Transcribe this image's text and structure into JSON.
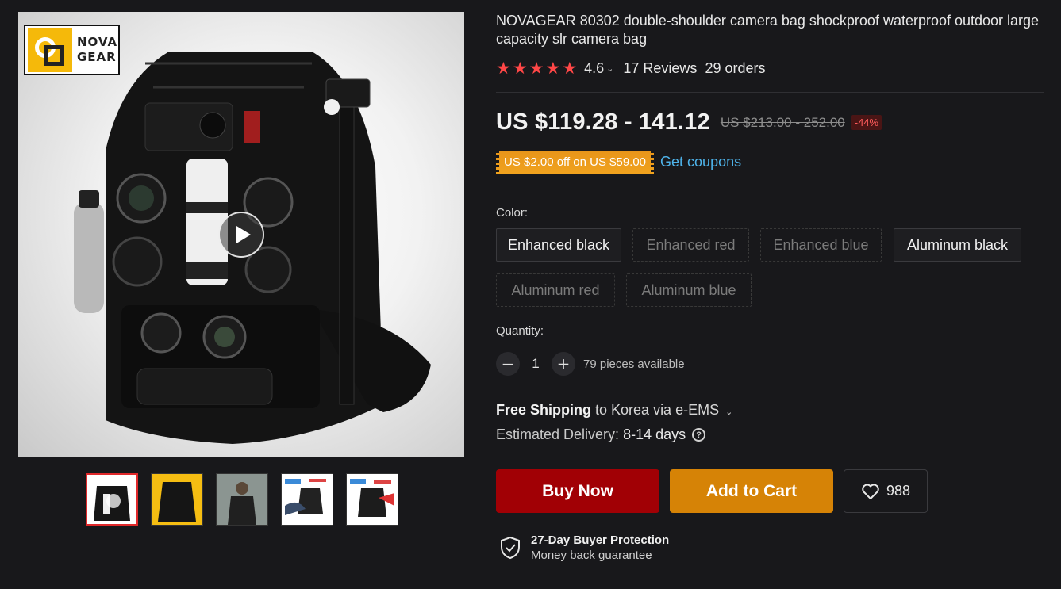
{
  "brand": {
    "line1": "NOVA",
    "line2": "GEAR"
  },
  "product": {
    "title": "NOVAGEAR 80302 double-shoulder camera bag shockproof waterproof outdoor large capacity slr camera bag",
    "rating": "4.6",
    "rating_value": 4.6,
    "reviews": "17 Reviews",
    "orders": "29 orders"
  },
  "price": {
    "current": "US $119.28 - 141.12",
    "original": "US $213.00 - 252.00",
    "discount": "-44%"
  },
  "coupon": {
    "text": "US $2.00 off on US $59.00",
    "link": "Get coupons"
  },
  "color": {
    "label": "Color:",
    "options": [
      {
        "label": "Enhanced black",
        "available": true
      },
      {
        "label": "Enhanced red",
        "available": false
      },
      {
        "label": "Enhanced blue",
        "available": false
      },
      {
        "label": "Aluminum black",
        "available": true
      },
      {
        "label": "Aluminum red",
        "available": false
      },
      {
        "label": "Aluminum blue",
        "available": false
      }
    ]
  },
  "quantity": {
    "label": "Quantity:",
    "value": "1",
    "minus": "−",
    "plus": "+",
    "available": "79 pieces available"
  },
  "shipping": {
    "free": "Free Shipping",
    "dest": " to Korea via e-EMS ",
    "chevron": "⌄",
    "delivery_label": "Estimated Delivery:",
    "delivery_days": "8-14 days",
    "help": "?"
  },
  "actions": {
    "buy": "Buy Now",
    "cart": "Add to Cart",
    "wishlist_count": "988"
  },
  "protection": {
    "title": "27-Day Buyer Protection",
    "subtitle": "Money back guarantee"
  },
  "gallery": {
    "thumbnails": [
      {
        "icon": "video-thumbnail",
        "active": true
      },
      {
        "icon": "bag-yellow-thumbnail",
        "active": false
      },
      {
        "icon": "person-thumbnail",
        "active": false
      },
      {
        "icon": "detail-thumbnail",
        "active": false
      },
      {
        "icon": "detail-thumbnail",
        "active": false
      }
    ]
  },
  "colors": {
    "accent": "#ff4747",
    "buy": "#a10005",
    "cart": "#d68306",
    "link": "#4eb3ea",
    "coupon": "#f0a21e"
  }
}
